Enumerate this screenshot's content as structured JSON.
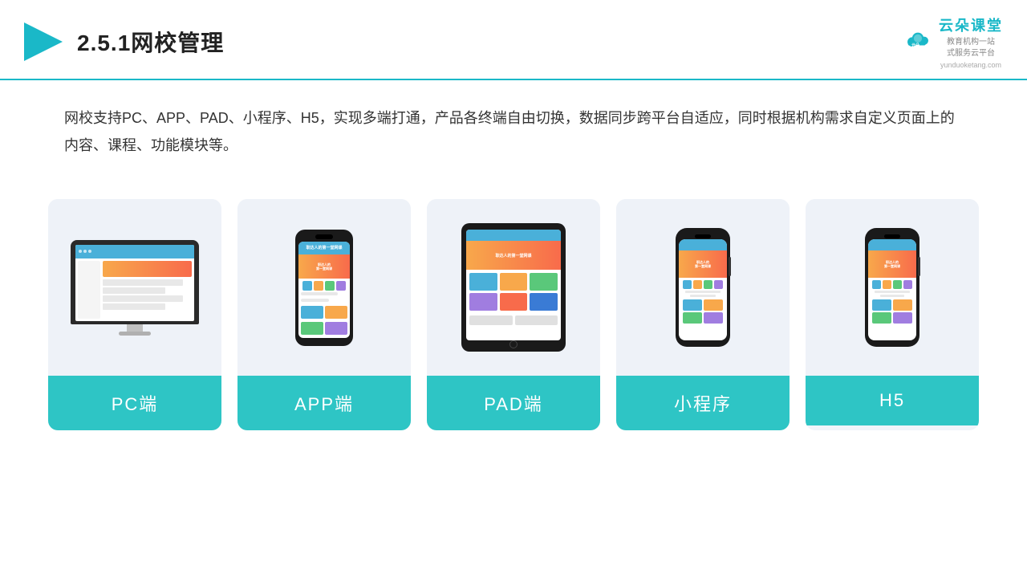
{
  "header": {
    "title": "2.5.1网校管理",
    "brand": {
      "name": "云朵课堂",
      "tagline": "教育机构一站\n式服务云平台",
      "url": "yunduoketang.com"
    }
  },
  "description": {
    "text": "网校支持PC、APP、PAD、小程序、H5，实现多端打通，产品各终端自由切换，数据同步跨平台自适应，同时根据机构需求自定义页面上的内容、课程、功能模块等。"
  },
  "cards": [
    {
      "id": "pc",
      "label": "PC端",
      "type": "pc"
    },
    {
      "id": "app",
      "label": "APP端",
      "type": "phone"
    },
    {
      "id": "pad",
      "label": "PAD端",
      "type": "tablet"
    },
    {
      "id": "miniprogram",
      "label": "小程序",
      "type": "phone-mini"
    },
    {
      "id": "h5",
      "label": "H5",
      "type": "phone-mini2"
    }
  ],
  "colors": {
    "teal": "#2ec5c5",
    "accent": "#1ab8c8",
    "headerBorder": "#1ab8c8"
  }
}
